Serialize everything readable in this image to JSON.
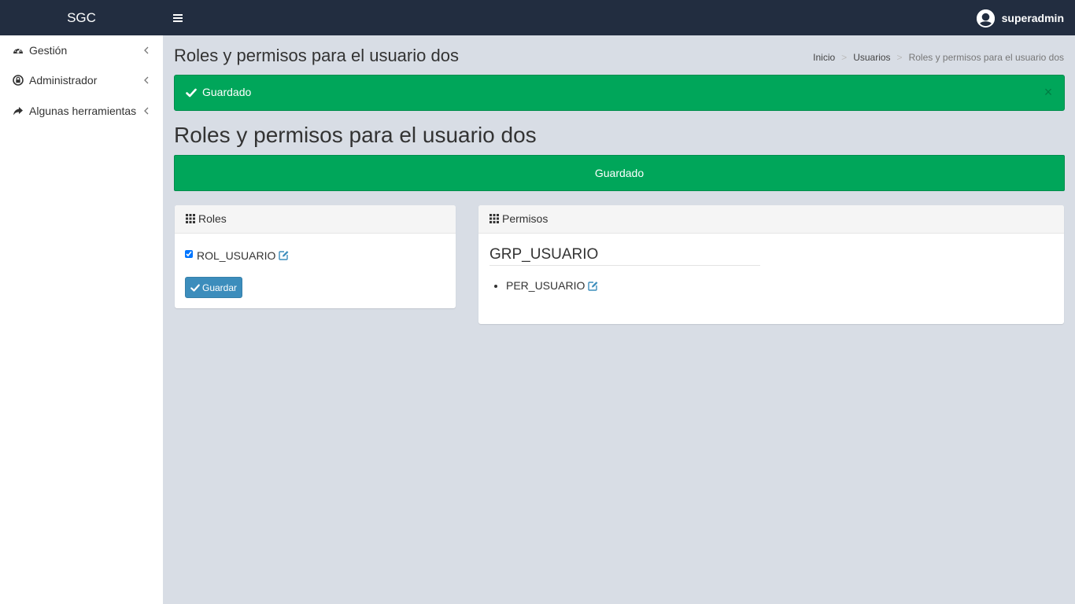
{
  "app": {
    "brand": "SGC"
  },
  "topbar": {
    "menu_icon": "bars-icon",
    "user_name": "superadmin",
    "user_icon": "user-circle-icon"
  },
  "sidebar": {
    "items": [
      {
        "label": "Gestión",
        "icon": "tachometer-icon"
      },
      {
        "label": "Administrador",
        "icon": "lock-circle-icon"
      },
      {
        "label": "Algunas herramientas",
        "icon": "share-icon"
      }
    ]
  },
  "header": {
    "title": "Roles y permisos para el usuario dos",
    "breadcrumb": [
      "Inicio",
      "Usuarios",
      "Roles y permisos para el usuario dos"
    ]
  },
  "alert": {
    "text": "Guardado",
    "close": "×"
  },
  "main": {
    "heading": "Roles y permisos para el usuario dos",
    "banner": "Guardado"
  },
  "roles": {
    "title": "Roles",
    "items": [
      {
        "label": "ROL_USUARIO",
        "checked": true
      }
    ],
    "save_label": "Guardar"
  },
  "permisos": {
    "title": "Permisos",
    "groups": [
      {
        "name": "GRP_USUARIO",
        "items": [
          "PER_USUARIO"
        ]
      }
    ]
  },
  "colors": {
    "topbar": "#222d40",
    "success": "#00a65a",
    "primary": "#3c8dbc",
    "background": "#d8dde5"
  }
}
